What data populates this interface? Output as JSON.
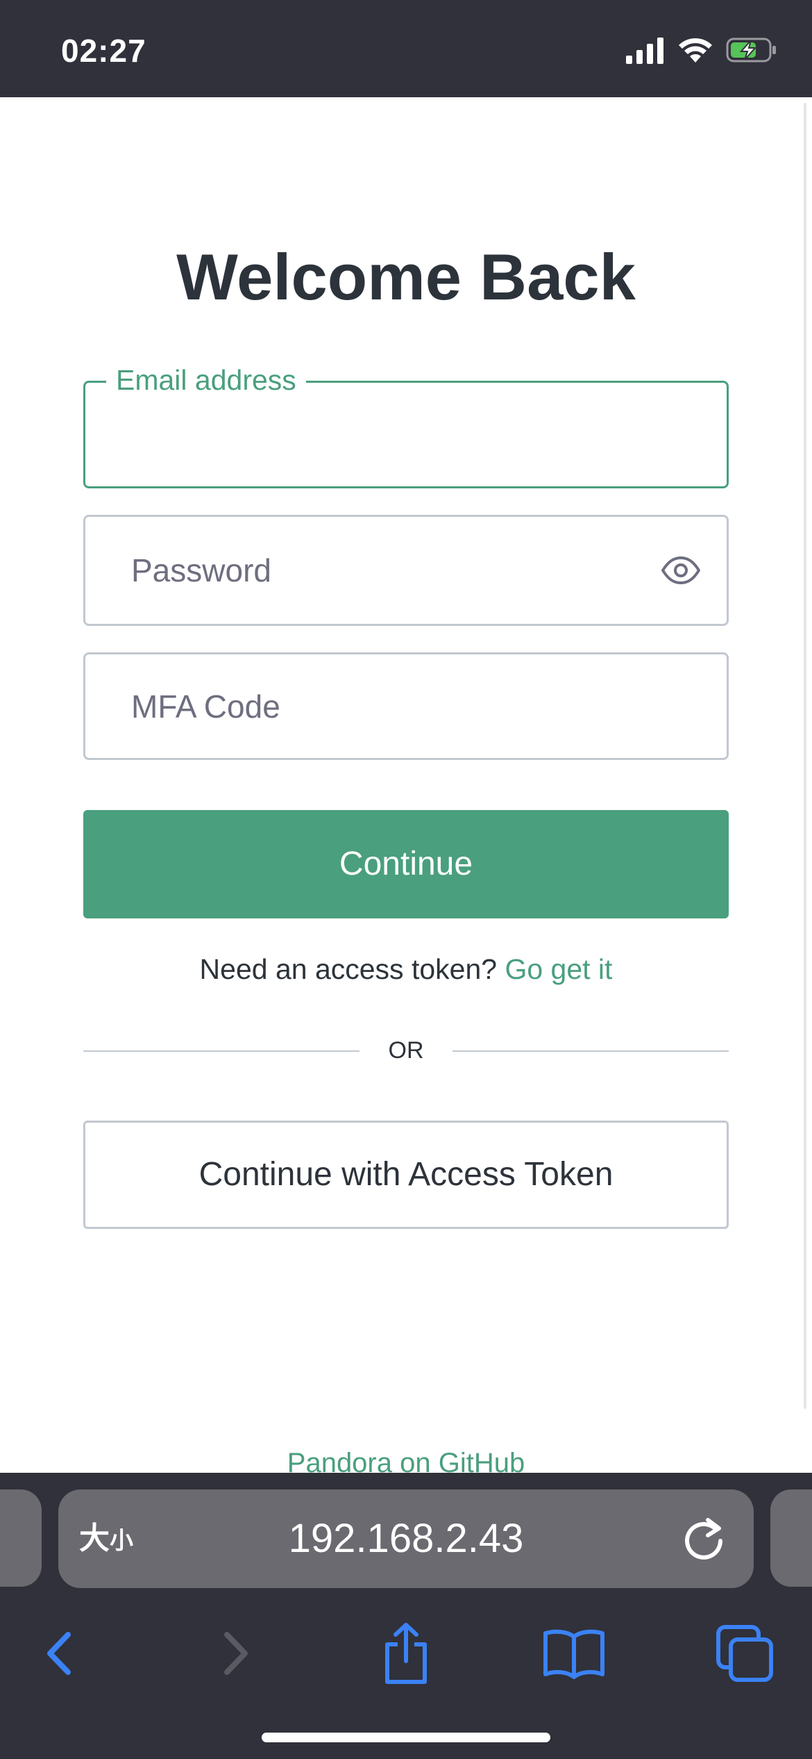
{
  "status_bar": {
    "time": "02:27"
  },
  "page": {
    "title": "Welcome Back",
    "email": {
      "label": "Email address",
      "value": ""
    },
    "password": {
      "placeholder": "Password"
    },
    "mfa": {
      "placeholder": "MFA Code"
    },
    "continue_label": "Continue",
    "token_prompt": "Need an access token?",
    "token_link": "Go get it",
    "divider": "OR",
    "token_button": "Continue with Access Token",
    "footer_link": "Pandora on GitHub"
  },
  "browser": {
    "text_size_label": "大",
    "text_size_small": "小",
    "url": "192.168.2.43"
  },
  "colors": {
    "accent": "#4a9f7e",
    "status_bar_bg": "#30313a",
    "toolbar_icon": "#3b82f6"
  },
  "icons": [
    "signal-icon",
    "wifi-icon",
    "battery-charging-icon",
    "eye-icon",
    "reload-icon",
    "back-icon",
    "forward-icon",
    "share-icon",
    "bookmarks-icon",
    "tabs-icon"
  ]
}
